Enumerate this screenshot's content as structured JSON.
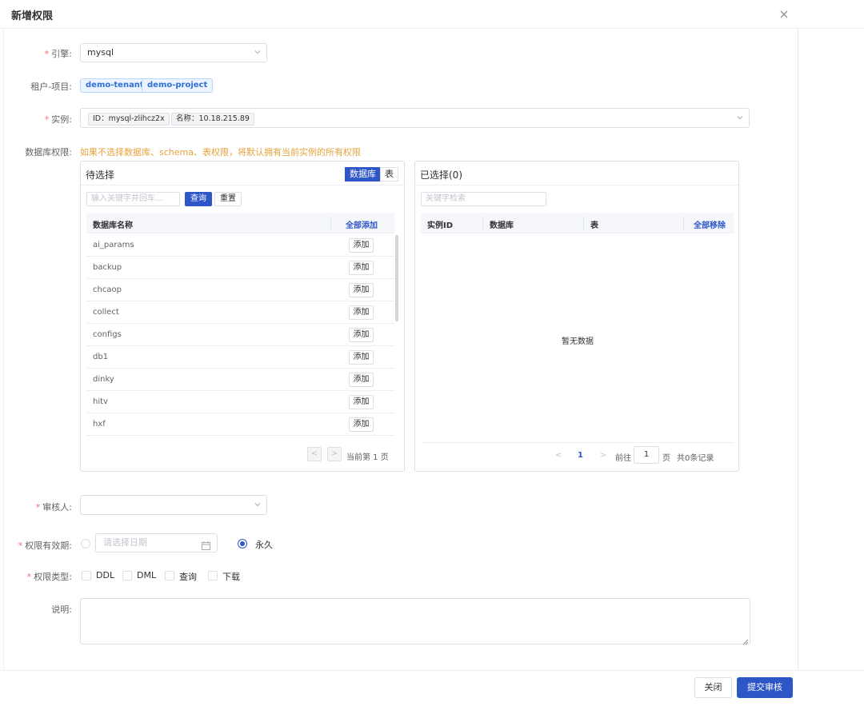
{
  "modal": {
    "title": "新增权限",
    "close": "×"
  },
  "form": {
    "engine": {
      "label": "引擎:",
      "value": "mysql"
    },
    "tenant": {
      "label": "租户-项目:",
      "tenant_tag": "demo-tenant",
      "project_tag": "demo-project"
    },
    "instance": {
      "label": "实例:",
      "id_tag": "ID：mysql-zlihcz2x",
      "name_tag": "名称：10.18.215.89"
    },
    "db_perm": {
      "label": "数据库权限:",
      "hint": "如果不选择数据库、schema、表权限，将默认拥有当前实例的所有权限"
    },
    "reviewer": {
      "label": "审核人:",
      "value": ""
    },
    "validity": {
      "label": "权限有效期:",
      "date_placeholder": "请选择日期",
      "forever": "永久"
    },
    "perm_type": {
      "label": "权限类型:",
      "options": [
        "DDL",
        "DML",
        "查询",
        "下载"
      ]
    },
    "desc": {
      "label": "说明:"
    }
  },
  "left_panel": {
    "title": "待选择",
    "seg_db": "数据库",
    "seg_table": "表",
    "search_placeholder": "输入关键字并回车...",
    "query_btn": "查询",
    "reset_btn": "重置",
    "col_name": "数据库名称",
    "add_all": "全部添加",
    "add_label": "添加",
    "rows": [
      "ai_params",
      "backup",
      "chcaop",
      "collect",
      "configs",
      "db1",
      "dinky",
      "hitv",
      "hxf"
    ],
    "pager_prev": "<",
    "pager_next": ">",
    "pager_text": "当前第 1 页"
  },
  "right_panel": {
    "title": "已选择(0)",
    "search_placeholder": "关键字检索",
    "cols": [
      "实例ID",
      "数据库",
      "表"
    ],
    "remove_all": "全部移除",
    "empty": "暂无数据",
    "pager_prev": "<",
    "pager_page": "1",
    "pager_next": ">",
    "goto": "前往",
    "goto_value": "1",
    "page_unit": "页",
    "total": "共0条记录"
  },
  "footer": {
    "close": "关闭",
    "submit": "提交审核"
  }
}
